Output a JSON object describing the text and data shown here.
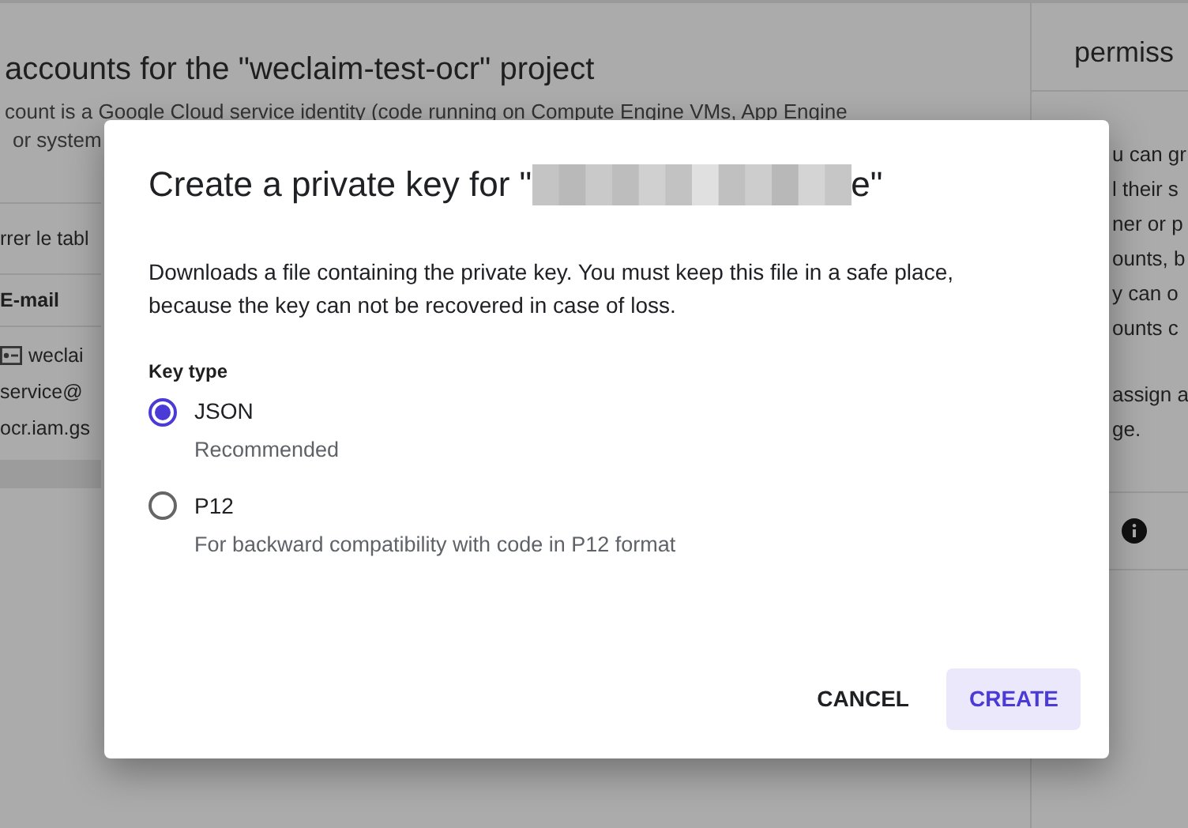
{
  "background": {
    "heading": "accounts for the \"weclaim-test-ocr\" project",
    "description": [
      "count is a Google Cloud service identity (code running on Compute Engine VMs, App Engine",
      "or system"
    ],
    "filter": "rrer le tabl",
    "column": "E-mail",
    "row": [
      "weclai",
      "service@",
      "ocr.iam.gs"
    ]
  },
  "side_panel": {
    "title": "permiss",
    "lines": [
      "u can gr",
      "l their s",
      "ner or p",
      "ounts, b",
      "y can o",
      "ounts c"
    ],
    "note": [
      "assign a",
      "ge."
    ]
  },
  "dialog": {
    "title_start": "Create a private key for \"",
    "title_end": "e\"",
    "description": "Downloads a file containing the private key. You must keep this file in a safe place, because the key can not be recovered in case of loss.",
    "key_type_label": "Key type",
    "options": [
      {
        "label": "JSON",
        "hint": "Recommended",
        "selected": true
      },
      {
        "label": "P12",
        "hint": "For backward compatibility with code in P12 format",
        "selected": false
      }
    ],
    "buttons": [
      {
        "label": "CANCEL",
        "kind": "text"
      },
      {
        "label": "CREATE",
        "kind": "tonal"
      }
    ]
  }
}
